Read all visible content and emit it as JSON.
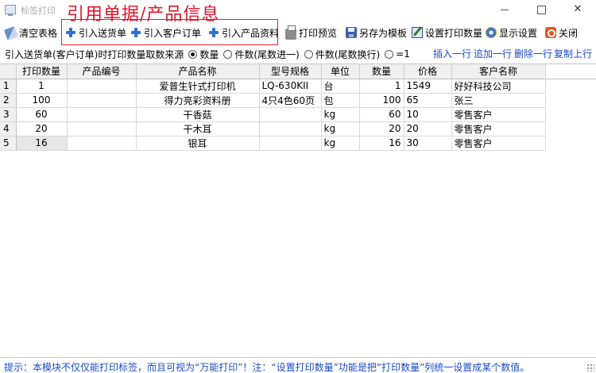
{
  "window": {
    "title": "标签打印",
    "overlay_caption": "引用单据/产品信息"
  },
  "toolbar": {
    "clear": "清空表格",
    "import_delivery": "引入送货单",
    "import_order": "引入客户订单",
    "import_product": "引入产品资料",
    "preview": "打印预览",
    "save_template": "另存为模板",
    "set_qty": "设置打印数量",
    "display": "显示设置",
    "close": "关闭"
  },
  "options": {
    "label": "引入送货单(客户订单)时打印数量取数来源",
    "radio_qty": "数量",
    "radio_ceil": "件数(尾数进一)",
    "radio_newline": "件数(尾数换行)",
    "radio_one": "=1",
    "selected": "数量"
  },
  "row_actions": {
    "insert": "插入一行",
    "append": "追加一行",
    "delete": "删除一行",
    "copy": "复制上行"
  },
  "table": {
    "headers": [
      "打印数量",
      "产品编号",
      "产品名称",
      "型号规格",
      "单位",
      "数量",
      "价格",
      "客户名称"
    ],
    "rows": [
      {
        "n": "1",
        "print_qty": "1",
        "code": "",
        "name": "爱普生针式打印机",
        "spec": "LQ-630KII",
        "unit": "台",
        "qty": "1",
        "price": "1549",
        "customer": "好好科技公司"
      },
      {
        "n": "2",
        "print_qty": "100",
        "code": "",
        "name": "得力亮彩资料册",
        "spec": "4只4色60页",
        "unit": "包",
        "qty": "100",
        "price": "65",
        "customer": "张三"
      },
      {
        "n": "3",
        "print_qty": "60",
        "code": "",
        "name": "干香菇",
        "spec": "",
        "unit": "kg",
        "qty": "60",
        "price": "10",
        "customer": "零售客户"
      },
      {
        "n": "4",
        "print_qty": "20",
        "code": "",
        "name": "干木耳",
        "spec": "",
        "unit": "kg",
        "qty": "20",
        "price": "20",
        "customer": "零售客户"
      },
      {
        "n": "5",
        "print_qty": "16",
        "code": "",
        "name": "银耳",
        "spec": "",
        "unit": "kg",
        "qty": "16",
        "price": "30",
        "customer": "零售客户"
      }
    ]
  },
  "status": {
    "text": "提示：本模块不仅仅能打印标签，而且可视为“万能打印”！注：“设置打印数量”功能是把“打印数量”列统一设置成某个数值。"
  }
}
